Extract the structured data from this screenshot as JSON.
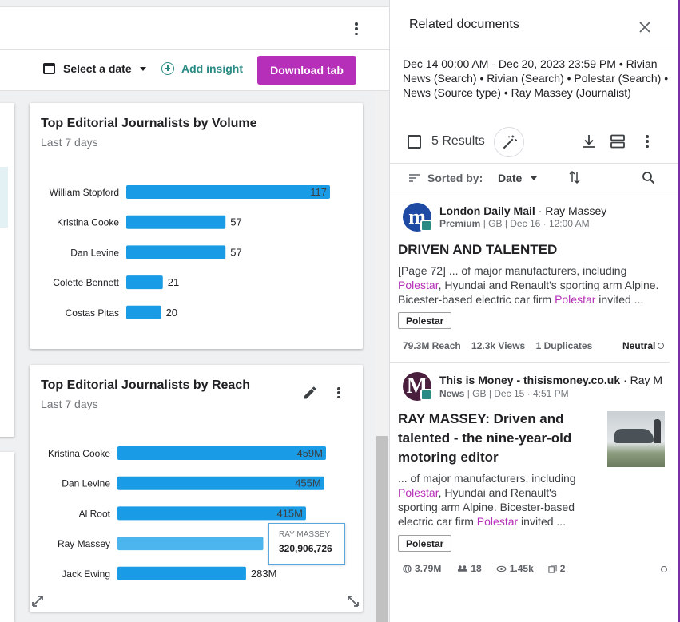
{
  "toolbar": {
    "date_label": "Select a date",
    "add_insight_label": "Add insight",
    "download_label": "Download tab"
  },
  "colors": {
    "accent": "#b62fb8",
    "teal": "#2a8a84",
    "bar_blue": "#1a9be6",
    "bar_highlight": "#4db5ee"
  },
  "card1": {
    "title": "Top Editorial Journalists by Volume",
    "subtitle": "Last 7 days"
  },
  "card2": {
    "title": "Top Editorial Journalists by Reach",
    "subtitle": "Last 7 days"
  },
  "chart_data": [
    {
      "type": "bar",
      "orientation": "horizontal",
      "title": "Top Editorial Journalists by Volume",
      "subtitle": "Last 7 days",
      "categories": [
        "William Stopford",
        "Kristina Cooke",
        "Dan Levine",
        "Colette Bennett",
        "Costas Pitas"
      ],
      "values": [
        117,
        57,
        57,
        21,
        20
      ],
      "value_labels": [
        "117",
        "57",
        "57",
        "21",
        "20"
      ],
      "xlim": [
        0,
        117
      ]
    },
    {
      "type": "bar",
      "orientation": "horizontal",
      "title": "Top Editorial Journalists by Reach",
      "subtitle": "Last 7 days",
      "categories": [
        "Kristina Cooke",
        "Dan Levine",
        "Al Root",
        "Ray Massey",
        "Jack Ewing"
      ],
      "values": [
        459000000,
        455000000,
        415000000,
        320906726,
        283000000
      ],
      "value_labels": [
        "459M",
        "455M",
        "415M",
        "",
        "283M"
      ],
      "highlighted": "Ray Massey",
      "xlim": [
        0,
        459000000
      ]
    }
  ],
  "tooltip": {
    "name": "RAY MASSEY",
    "value": "320,906,726"
  },
  "panel": {
    "title": "Related documents",
    "filter_description": "Dec 14 00:00 AM - Dec 20, 2023 23:59 PM  •  Rivian News (Search) • Rivian (Search) • Polestar (Search)  •  News (Source type)  •  Ray Massey (Journalist)",
    "results_count": "5 Results",
    "sort_label": "Sorted by:",
    "sort_value": "Date"
  },
  "articles": [
    {
      "source": "London Daily Mail",
      "separator": " · ",
      "author": "Ray Massey",
      "meta_kind": "Premium",
      "meta_rest": " | GB | Dec 16 · 12:00 AM",
      "logo_letter": "m",
      "logo_color": "#1f4aa3",
      "title": "DRIVEN AND TALENTED",
      "snippet_parts": [
        {
          "text": "[Page 72] ... of major manufacturers, including "
        },
        {
          "text": "Polestar",
          "hl": true
        },
        {
          "text": ", Hyundai and Renault's sporting arm Alpine. Bicester-based electric car firm "
        },
        {
          "text": "Polestar",
          "hl": true
        },
        {
          "text": " invited ..."
        }
      ],
      "tag": "Polestar",
      "reach": "79.3M Reach",
      "views": "12.3k Views",
      "duplicates_num": "1",
      "duplicates_label": "Duplicates",
      "sentiment": "Neutral"
    },
    {
      "source": "This is Money - thisismoney.co.uk",
      "separator": " · ",
      "author": "Ray M",
      "meta_kind": "News",
      "meta_rest": " | GB | Dec 15 · 4:51 PM",
      "logo_letter": "M",
      "logo_color": "#4a1f3d",
      "title": "RAY MASSEY: Driven and talented - the nine-year-old motoring editor",
      "snippet_parts": [
        {
          "text": "... of major manufacturers, including "
        },
        {
          "text": "Polestar",
          "hl": true
        },
        {
          "text": ", Hyundai and Renault's sporting arm Alpine. Bicester-based electric car firm "
        },
        {
          "text": "Polestar",
          "hl": true
        },
        {
          "text": " invited ..."
        }
      ],
      "tag": "Polestar",
      "reach": "3.79M",
      "social": "18",
      "views": "1.45k",
      "duplicates": "2"
    }
  ]
}
